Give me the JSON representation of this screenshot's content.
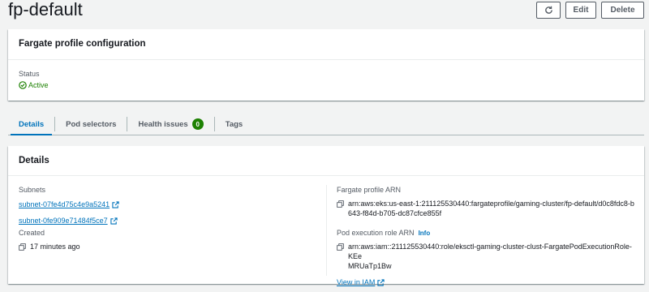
{
  "header": {
    "title": "fp-default",
    "edit_label": "Edit",
    "delete_label": "Delete"
  },
  "config": {
    "title": "Fargate profile configuration",
    "status_label": "Status",
    "status_value": "Active"
  },
  "tabs": {
    "details": "Details",
    "pod_selectors": "Pod selectors",
    "health_issues": "Health issues",
    "health_issues_count": "0",
    "tags": "Tags"
  },
  "details": {
    "title": "Details",
    "subnets_label": "Subnets",
    "subnets": [
      "subnet-07fe4d75c4e9a5241",
      "subnet-0fe909e71484f5ce7"
    ],
    "created_label": "Created",
    "created_value": "17 minutes ago",
    "profile_arn_label": "Fargate profile ARN",
    "profile_arn_line1": "arn:aws:eks:us-east-1:211125530440:fargateprofile/gaming-cluster/fp-default/d0c8fdc8-b",
    "profile_arn_line2": "643-f84d-b705-dc87cfce855f",
    "pod_role_label": "Pod execution role ARN",
    "info_label": "Info",
    "pod_role_line1": "arn:aws:iam::211125530440:role/eksctl-gaming-cluster-clust-FargatePodExecutionRole-KEe",
    "pod_role_line2": "MRUaTp1Bw",
    "view_iam_label": "View in IAM"
  },
  "colors": {
    "accent": "#0073bb",
    "success": "#1d8102"
  }
}
